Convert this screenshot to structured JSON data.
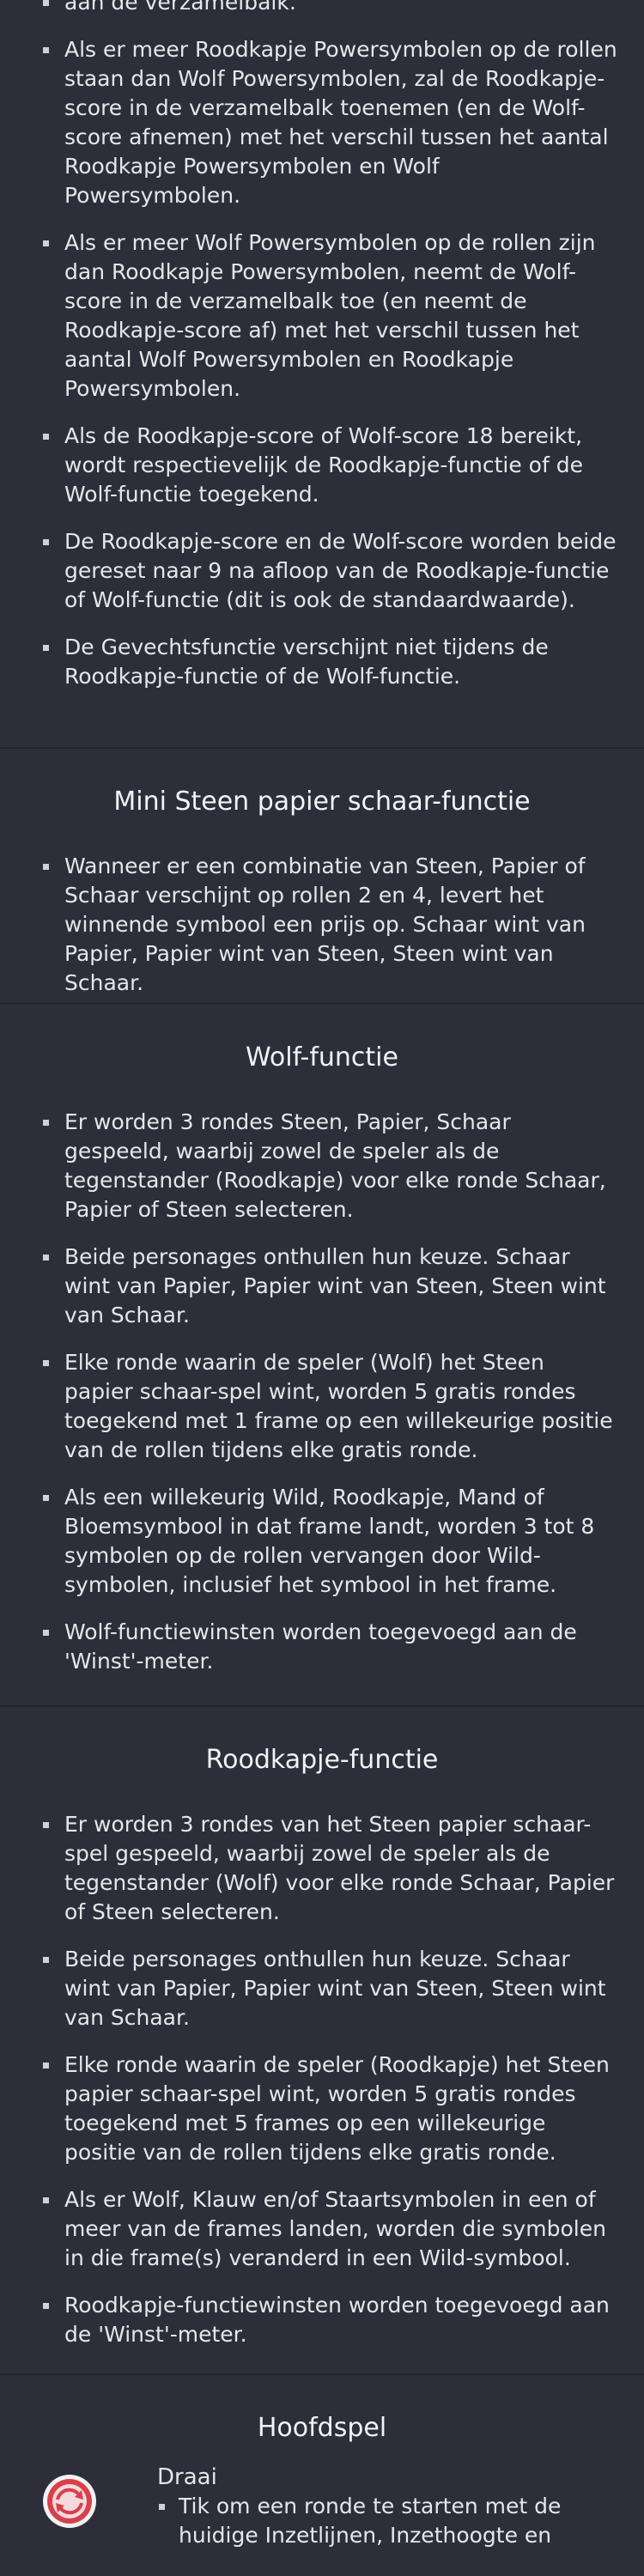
{
  "intro": {
    "items": [
      "aan de verzamelbalk.",
      "Als er meer Roodkapje Powersymbolen op de rollen staan dan Wolf Powersymbolen, zal de Roodkapje-score in de verzamelbalk toenemen (en de Wolf-score afnemen) met het verschil tussen het aantal Roodkapje Powersymbolen en Wolf Powersymbolen.",
      "Als er meer Wolf Powersymbolen op de rollen zijn dan Roodkapje Powersymbolen, neemt de Wolf-score in de verzamelbalk toe (en neemt de Roodkapje-score af) met het verschil tussen het aantal Wolf Powersymbolen en Roodkapje Powersymbolen.",
      "Als de Roodkapje-score of Wolf-score 18 bereikt, wordt respectievelijk de Roodkapje-functie of de Wolf-functie toegekend.",
      "De Roodkapje-score en de Wolf-score worden beide gereset naar 9 na afloop van de Roodkapje-functie of Wolf-functie (dit is ook de standaardwaarde).",
      "De Gevechtsfunctie verschijnt niet tijdens de Roodkapje-functie of de Wolf-functie."
    ]
  },
  "mini": {
    "title": "Mini Steen papier schaar-functie",
    "items": [
      "Wanneer er een combinatie van Steen, Papier of Schaar verschijnt op rollen 2 en 4, levert het winnende symbool een prijs op. Schaar wint van Papier, Papier wint van Steen, Steen wint van Schaar."
    ]
  },
  "wolf": {
    "title": "Wolf-functie",
    "items": [
      "Er worden 3 rondes Steen, Papier, Schaar gespeeld, waarbij zowel de speler als de tegenstander (Roodkapje) voor elke ronde Schaar, Papier of Steen selecteren.",
      "Beide personages onthullen hun keuze. Schaar wint van Papier, Papier wint van Steen, Steen wint van Schaar.",
      "Elke ronde waarin de speler (Wolf) het Steen papier schaar-spel wint, worden 5 gratis rondes toegekend met 1 frame op een willekeurige positie van de rollen tijdens elke gratis ronde.",
      "Als een willekeurig Wild, Roodkapje, Mand of Bloemsymbool in dat frame landt, worden 3 tot 8 symbolen op de rollen vervangen door Wild-symbolen, inclusief het symbool in het frame.",
      "Wolf-functiewinsten worden toegevoegd aan de 'Winst'-meter."
    ]
  },
  "rood": {
    "title": "Roodkapje-functie",
    "items": [
      "Er worden 3 rondes van het Steen papier schaar-spel gespeeld, waarbij zowel de speler als de tegenstander (Wolf) voor elke ronde Schaar, Papier of Steen selecteren.",
      "Beide personages onthullen hun keuze. Schaar wint van Papier, Papier wint van Steen, Steen wint van Schaar.",
      "Elke ronde waarin de speler (Roodkapje) het Steen papier schaar-spel wint, worden 5 gratis rondes toegekend met 5 frames op een willekeurige positie van de rollen tijdens elke gratis ronde.",
      "Als er Wolf, Klauw en/of Staartsymbolen in een of meer van de frames landen, worden die symbolen in die frame(s) veranderd in een Wild-symbool.",
      "Roodkapje-functiewinsten worden toegevoegd aan de 'Winst'-meter."
    ]
  },
  "main": {
    "title": "Hoofdspel",
    "spin_label": "Draai",
    "spin_icon": "spin-icon",
    "spin_text": "Tik om een ronde te starten met de huidige Inzetlijnen, Inzethoogte en",
    "colors": {
      "icon_red": "#d8404a",
      "icon_ring": "#f2f2f2"
    }
  }
}
